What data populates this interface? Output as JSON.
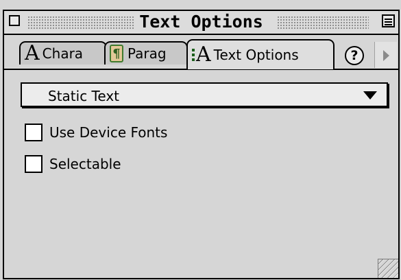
{
  "window": {
    "title": "Text Options"
  },
  "tabs": [
    {
      "glyph": "A",
      "label": "Chara",
      "icon": "character-A-icon",
      "active": false
    },
    {
      "glyph": "¶",
      "label": "Parag",
      "icon": "paragraph-icon",
      "active": false
    },
    {
      "glyph": "A",
      "label": "Text Options",
      "icon": "text-options-A-icon",
      "active": true
    }
  ],
  "help": {
    "symbol": "?"
  },
  "text_type": {
    "selected": "Static Text"
  },
  "options": [
    {
      "label": "Use Device Fonts",
      "checked": false
    },
    {
      "label": "Selectable",
      "checked": false
    }
  ],
  "colors": {
    "background": "#d6d6d6",
    "paragraph_icon_fill": "#e2c897",
    "paragraph_icon_green": "#3f7a2e"
  }
}
